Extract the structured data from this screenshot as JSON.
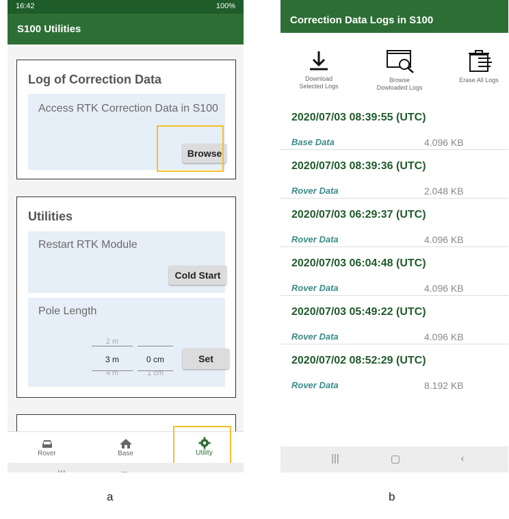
{
  "screen_a": {
    "status_time": "16:42",
    "status_right": "100%",
    "app_title": "S100 Utilities",
    "log_card": {
      "title": "Log of Correction Data",
      "section_label": "Access RTK Correction Data in S100",
      "button": "Browse"
    },
    "utilities_card": {
      "title": "Utilities",
      "restart_label": "Restart RTK Module",
      "restart_button": "Cold Start",
      "pole_label": "Pole Length",
      "meter_picker": {
        "above": "2 m",
        "current": "3 m",
        "below": "4 m"
      },
      "cm_picker": {
        "above": "",
        "current": "0 cm",
        "below": "1 cm"
      },
      "set_button": "Set"
    },
    "bottom_nav": [
      {
        "label": "Rover",
        "icon": "car-icon"
      },
      {
        "label": "Base",
        "icon": "home-icon"
      },
      {
        "label": "Utility",
        "icon": "gear-icon",
        "active": true
      }
    ],
    "highlight_color": "#f5c02a",
    "accent_color": "#2d6e35"
  },
  "screen_b": {
    "app_title": "Correction Data Logs in S100",
    "tools": [
      {
        "label": "Download Selected Logs",
        "icon": "download-icon"
      },
      {
        "label": "Browse Dowloaded Logs",
        "icon": "browse-window-icon"
      },
      {
        "label": "Erase All Logs",
        "icon": "trash-icon"
      }
    ],
    "logs": [
      {
        "timestamp": "2020/07/03 08:39:55 (UTC)",
        "type": "Base Data",
        "size": "4.096 KB"
      },
      {
        "timestamp": "2020/07/03 08:39:36 (UTC)",
        "type": "Rover Data",
        "size": "2.048 KB"
      },
      {
        "timestamp": "2020/07/03 06:29:37 (UTC)",
        "type": "Rover Data",
        "size": "4.096 KB"
      },
      {
        "timestamp": "2020/07/03 06:04:48 (UTC)",
        "type": "Rover Data",
        "size": "4.096 KB"
      },
      {
        "timestamp": "2020/07/03 05:49:22 (UTC)",
        "type": "Rover Data",
        "size": "4.096 KB"
      },
      {
        "timestamp": "2020/07/02 08:52:29 (UTC)",
        "type": "Rover Data",
        "size": "8.192 KB"
      }
    ]
  },
  "captions": {
    "a": "a",
    "b": "b"
  }
}
